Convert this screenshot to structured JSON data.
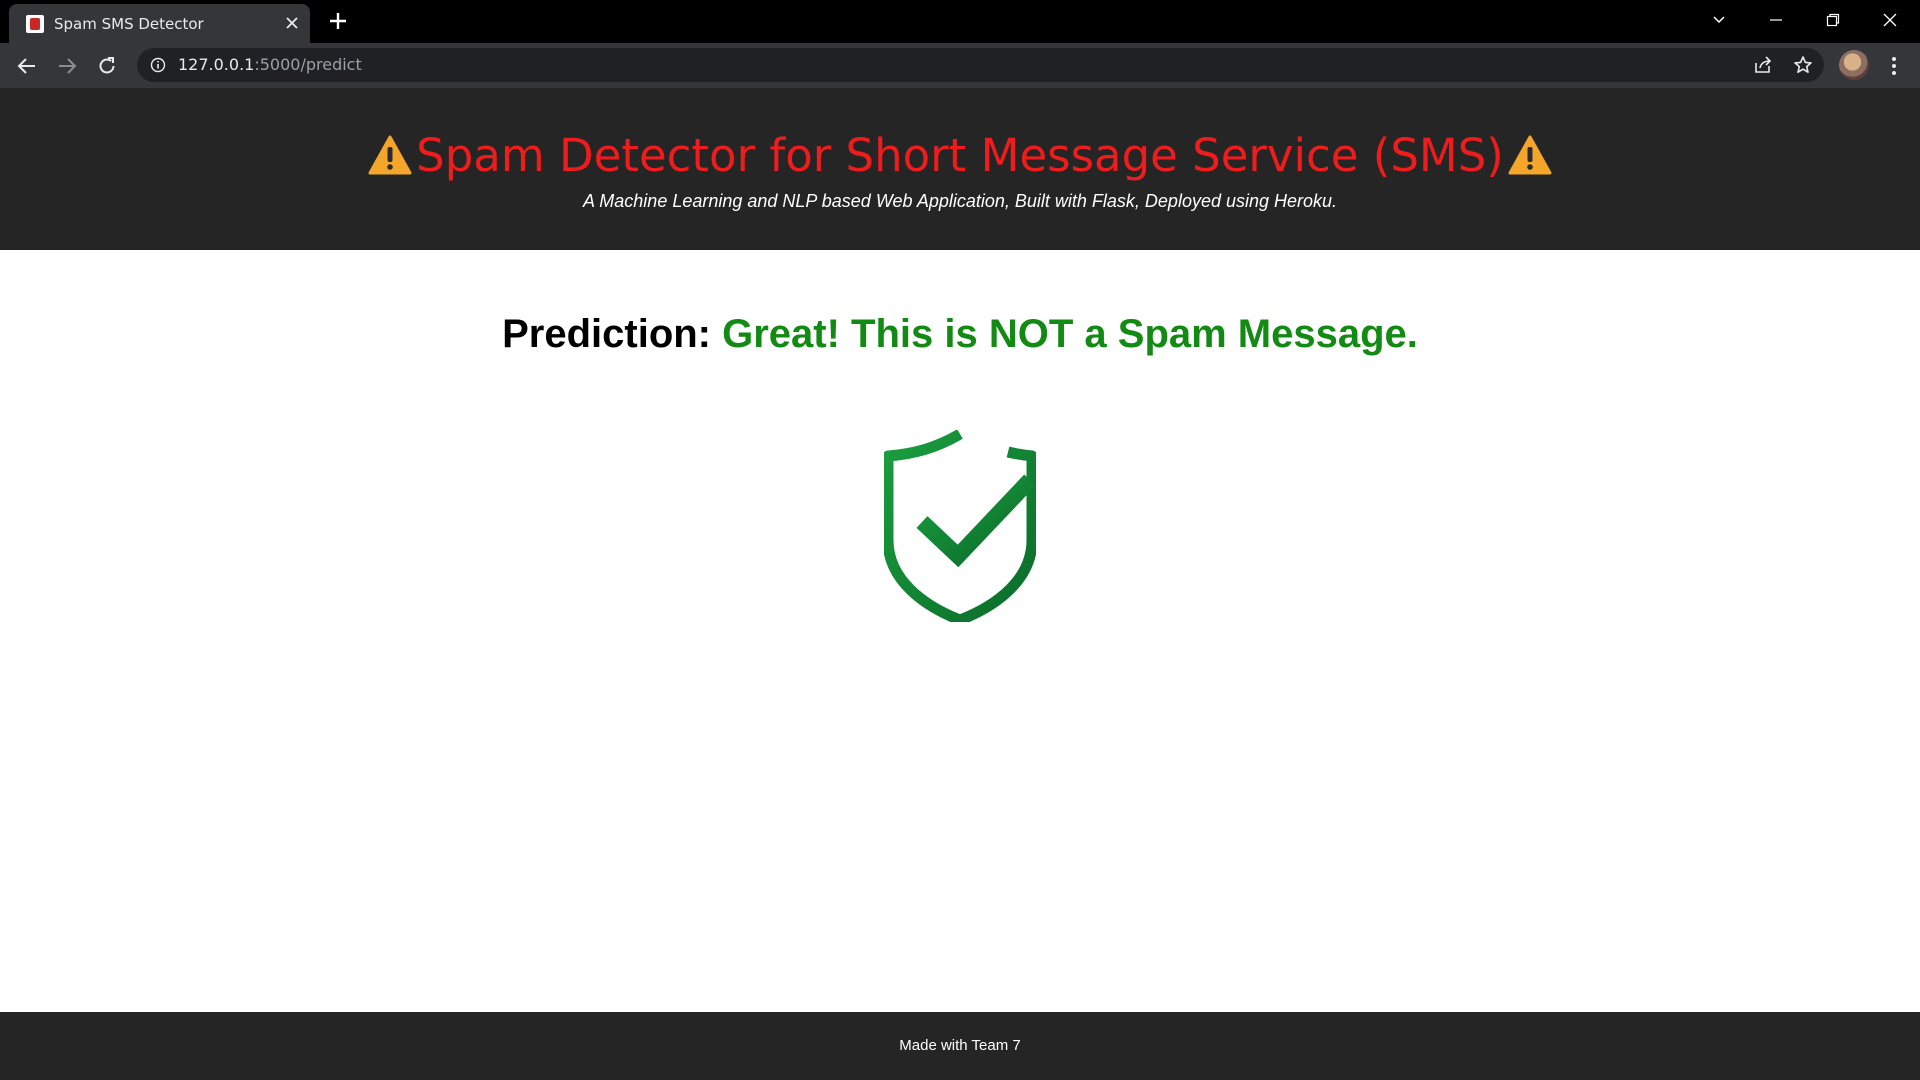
{
  "browser": {
    "tab_title": "Spam SMS Detector",
    "url_host": "127.0.0.1",
    "url_path": ":5000/predict"
  },
  "header": {
    "title": "Spam Detector for Short Message Service (SMS)",
    "subtitle": "A Machine Learning and NLP based Web Application, Built with Flask, Deployed using Heroku."
  },
  "result": {
    "label": "Prediction:",
    "text": "Great! This is NOT a Spam Message."
  },
  "footer": {
    "text": "Made with Team 7"
  },
  "colors": {
    "title_red": "#ee1c1c",
    "result_green": "#138a13",
    "header_bg": "#252525"
  },
  "icons": {
    "warning": "warning-triangle-icon",
    "status": "shield-check-icon"
  }
}
